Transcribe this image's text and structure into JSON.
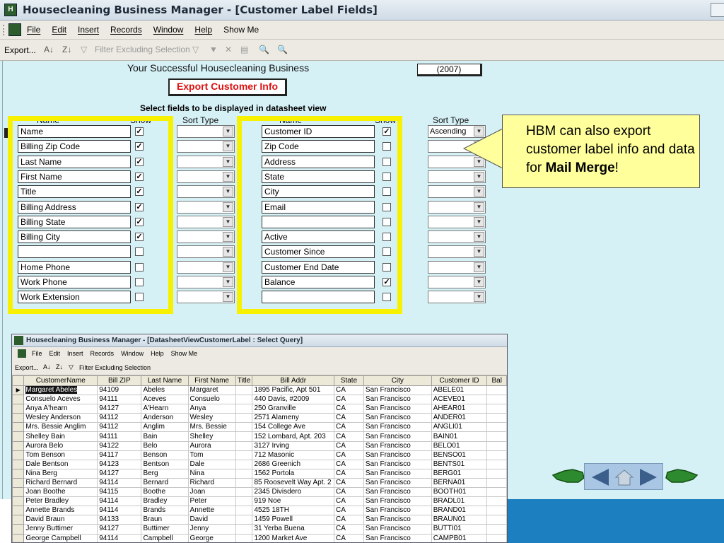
{
  "window": {
    "title": "Housecleaning Business Manager - [Customer Label Fields]",
    "menu": [
      "File",
      "Edit",
      "Insert",
      "Records",
      "Window",
      "Help",
      "Show Me"
    ],
    "toolbar": {
      "export_label": "Export...",
      "filter_label": "Filter Excluding Selection"
    }
  },
  "form": {
    "business_heading": "Your Successful Housecleaning Business",
    "year": "(2007)",
    "export_button": "Export Customer Info",
    "select_title": "Select fields to be displayed in datasheet view",
    "col_name": "Name",
    "col_show": "Show",
    "col_sort": "Sort Type",
    "left_fields": [
      {
        "label": "Name",
        "show": true
      },
      {
        "label": "Billing Zip Code",
        "show": true
      },
      {
        "label": "Last Name",
        "show": true
      },
      {
        "label": "First Name",
        "show": true
      },
      {
        "label": "Title",
        "show": true
      },
      {
        "label": "Billing Address",
        "show": true
      },
      {
        "label": "Billing State",
        "show": true
      },
      {
        "label": "Billing City",
        "show": true
      },
      {
        "label": "",
        "show": false
      },
      {
        "label": "Home Phone",
        "show": false
      },
      {
        "label": "Work Phone",
        "show": false
      },
      {
        "label": "Work Extension",
        "show": false
      }
    ],
    "right_fields": [
      {
        "label": "Customer ID",
        "show": true,
        "sort": "Ascending"
      },
      {
        "label": "Zip Code",
        "show": false,
        "sort": ""
      },
      {
        "label": "Address",
        "show": false,
        "sort": ""
      },
      {
        "label": "State",
        "show": false,
        "sort": ""
      },
      {
        "label": "City",
        "show": false,
        "sort": ""
      },
      {
        "label": "Email",
        "show": false,
        "sort": ""
      },
      {
        "label": "",
        "show": false,
        "sort": ""
      },
      {
        "label": "Active",
        "show": false,
        "sort": ""
      },
      {
        "label": "Customer Since",
        "show": false,
        "sort": ""
      },
      {
        "label": "Customer End Date",
        "show": false,
        "sort": ""
      },
      {
        "label": "Balance",
        "show": true,
        "sort": ""
      },
      {
        "label": "",
        "show": false,
        "sort": ""
      }
    ]
  },
  "callout": {
    "text_before": "HBM can also export customer label info and data for ",
    "text_bold": "Mail Merge",
    "text_after": "!"
  },
  "datasheet": {
    "title": "Housecleaning Business Manager - [DatasheetViewCustomerLabel : Select Query]",
    "menu": [
      "File",
      "Edit",
      "Insert",
      "Records",
      "Window",
      "Help",
      "Show Me"
    ],
    "toolbar": {
      "export_label": "Export...",
      "filter_label": "Filter Excluding Selection"
    },
    "columns": [
      "CustomerName",
      "Bill ZIP",
      "Last Name",
      "First Name",
      "Title",
      "Bill Addr",
      "State",
      "City",
      "Customer ID",
      "Bal"
    ],
    "rows": [
      [
        "Margaret Abeles",
        "94109",
        "Abeles",
        "Margaret",
        "",
        "1895 Pacific, Apt 501",
        "CA",
        "San Francisco",
        "ABELE01"
      ],
      [
        "Consuelo Aceves",
        "94111",
        "Aceves",
        "Consuelo",
        "",
        "440 Davis, #2009",
        "CA",
        "San Francisco",
        "ACEVE01"
      ],
      [
        "Anya A'hearn",
        "94127",
        "A'Hearn",
        "Anya",
        "",
        "250 Granville",
        "CA",
        "San Francisco",
        "AHEAR01"
      ],
      [
        "Wesley Anderson",
        "94112",
        "Anderson",
        "Wesley",
        "",
        "2571 Alameny",
        "CA",
        "San Francisco",
        "ANDER01"
      ],
      [
        "Mrs. Bessie Anglim",
        "94112",
        "Anglim",
        "Mrs. Bessie",
        "",
        "154 College Ave",
        "CA",
        "San Francisco",
        "ANGLI01"
      ],
      [
        "Shelley Bain",
        "94111",
        "Bain",
        "Shelley",
        "",
        "152 Lombard, Apt. 203",
        "CA",
        "San Francisco",
        "BAIN01"
      ],
      [
        "Aurora Belo",
        "94122",
        "Belo",
        "Aurora",
        "",
        "3127 Irving",
        "CA",
        "San Francisco",
        "BELO01"
      ],
      [
        "Tom Benson",
        "94117",
        "Benson",
        "Tom",
        "",
        "712 Masonic",
        "CA",
        "San Francisco",
        "BENSO01"
      ],
      [
        "Dale Bentson",
        "94123",
        "Bentson",
        "Dale",
        "",
        "2686 Greenich",
        "CA",
        "San Francisco",
        "BENTS01"
      ],
      [
        "Nina Berg",
        "94127",
        "Berg",
        "Nina",
        "",
        "1562 Portola",
        "CA",
        "San Francisco",
        "BERG01"
      ],
      [
        "Richard Bernard",
        "94114",
        "Bernard",
        "Richard",
        "",
        "85 Roosevelt Way Apt. 2",
        "CA",
        "San Francisco",
        "BERNA01"
      ],
      [
        "Joan Boothe",
        "94115",
        "Boothe",
        "Joan",
        "",
        "2345 Divisdero",
        "CA",
        "San Francisco",
        "BOOTH01"
      ],
      [
        "Peter Bradley",
        "94114",
        "Bradley",
        "Peter",
        "",
        "919 Noe",
        "CA",
        "San Francisco",
        "BRADL01"
      ],
      [
        "Annette Brands",
        "94114",
        "Brands",
        "Annette",
        "",
        "4525 18TH",
        "CA",
        "San Francisco",
        "BRAND01"
      ],
      [
        "David Braun",
        "94133",
        "Braun",
        "David",
        "",
        "1459 Powell",
        "CA",
        "San Francisco",
        "BRAUN01"
      ],
      [
        "Jenny Buttimer",
        "94127",
        "Buttimer",
        "Jenny",
        "",
        "31 Yerba Buena",
        "CA",
        "San Francisco",
        "BUTTI01"
      ],
      [
        "George Campbell",
        "94114",
        "Campbell",
        "George",
        "",
        "1200 Market Ave",
        "CA",
        "San Francisco",
        "CAMPB01"
      ]
    ]
  }
}
